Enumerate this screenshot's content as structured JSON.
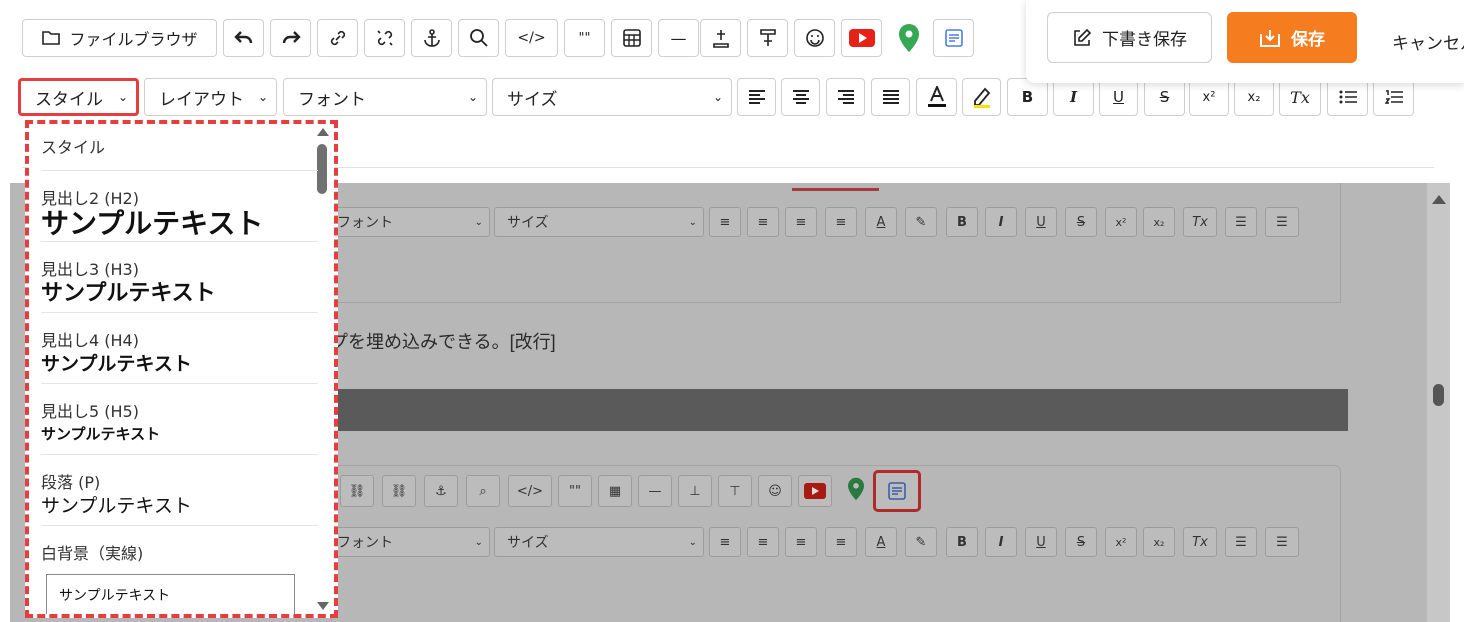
{
  "toolbar": {
    "file_browser": "ファイルブラウザ",
    "code": "</>",
    "quote": "\"\"",
    "hr": "—",
    "style": "スタイル",
    "layout": "レイアウト",
    "font": "フォント",
    "size": "サイズ",
    "bold": "B",
    "italic": "I",
    "underline": "U",
    "strike": "S",
    "superscript": "x²",
    "subscript": "x₂",
    "clear_format": "Tx"
  },
  "actions": {
    "draft_save": "下書き保存",
    "save": "保存",
    "cancel": "キャンセル"
  },
  "dropdown": {
    "header": "スタイル",
    "items": [
      {
        "label": "見出し2 (H2)",
        "sample": "サンプルテキスト"
      },
      {
        "label": "見出し3 (H3)",
        "sample": "サンプルテキスト"
      },
      {
        "label": "見出し4 (H4)",
        "sample": "サンプルテキスト"
      },
      {
        "label": "見出し5 (H5)",
        "sample": "サンプルテキスト"
      },
      {
        "label": "段落 (P)",
        "sample": "サンプルテキスト"
      },
      {
        "label": "白背景（実線)",
        "sample": "サンプルテキスト"
      }
    ]
  },
  "background": {
    "font": "フォント",
    "size": "サイズ",
    "body_text": "プを埋め込みできる。[改行]"
  },
  "colors": {
    "accent_orange": "#f57c1f",
    "highlight_red": "#e53e3e",
    "youtube_red": "#e62117",
    "map_green": "#34a853"
  }
}
